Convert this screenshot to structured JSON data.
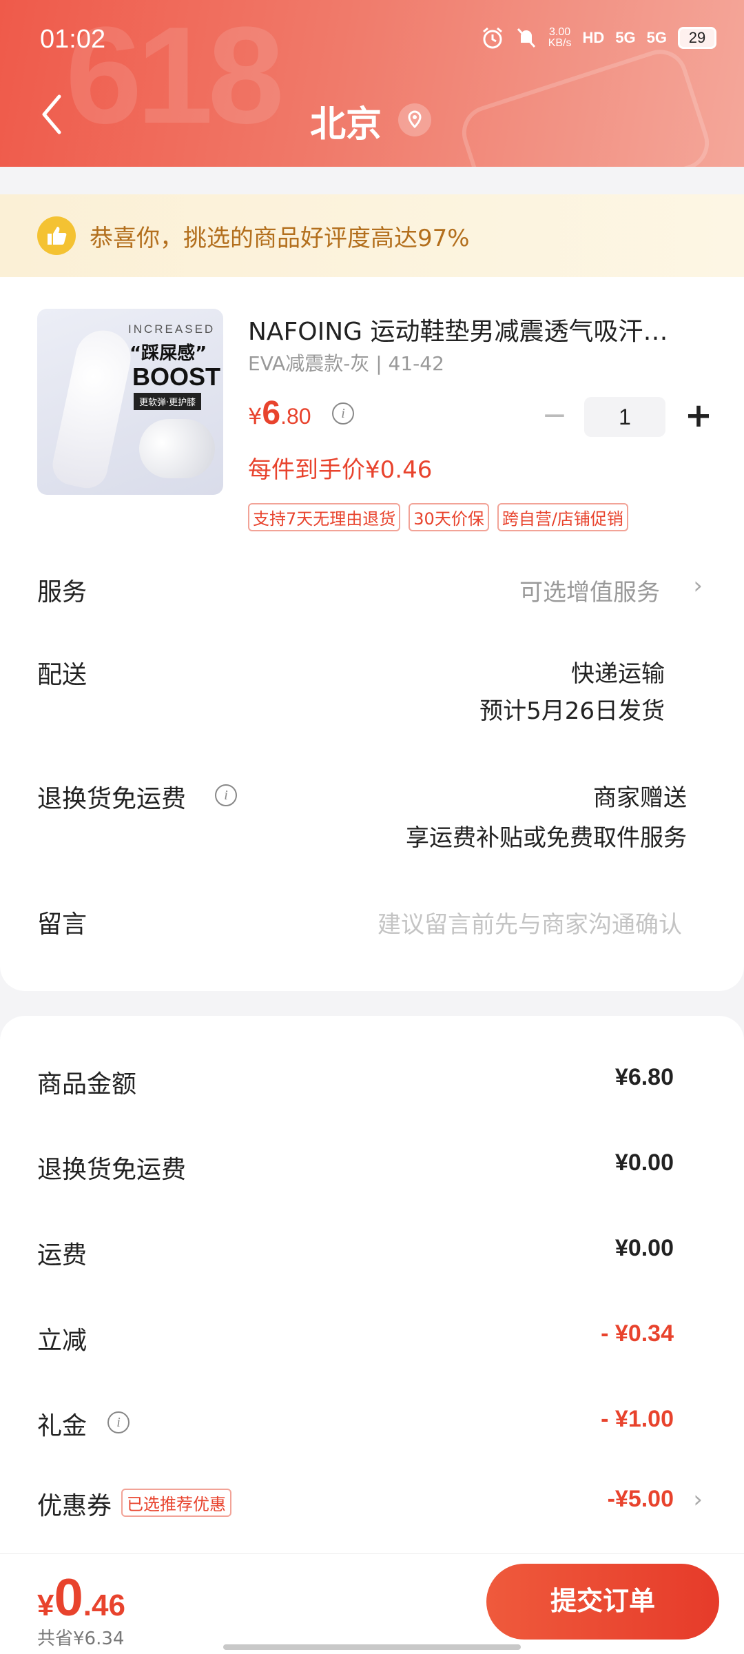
{
  "status_bar": {
    "time": "01:02",
    "speed": "3.00",
    "speed_unit": "KB/s",
    "hd": "HD",
    "net1": "5G",
    "net2": "5G",
    "battery": "29"
  },
  "nav": {
    "title": "北京"
  },
  "praise": {
    "text": "恭喜你，挑选的商品好评度高达97%"
  },
  "product": {
    "image_text": {
      "line1": "INCREASED",
      "line2": "“踩屎感”",
      "line3": "BOOST",
      "line4": "更软弹·更护膝"
    },
    "title": "NAFOING 运动鞋垫男减震透气吸汗…",
    "spec": "EVA减震款-灰 | 41-42",
    "price_currency": "¥",
    "price_int": "6",
    "price_dec": ".80",
    "unit_price": "每件到手价¥0.46",
    "quantity": "1",
    "minus": "−",
    "plus": "+",
    "tags": [
      "支持7天无理由退货",
      "30天价保",
      "跨自营/店铺促销"
    ]
  },
  "rows": {
    "service": {
      "label": "服务",
      "value": "可选增值服务"
    },
    "delivery": {
      "label": "配送",
      "value": "快递运输",
      "sub": "预计5月26日发货"
    },
    "return": {
      "label": "退换货免运费",
      "value": "商家赠送",
      "sub": "享运费补贴或免费取件服务"
    },
    "message": {
      "label": "留言",
      "placeholder": "建议留言前先与商家沟通确认"
    }
  },
  "summary": {
    "goods": {
      "label": "商品金额",
      "value": "¥6.80"
    },
    "return_fee": {
      "label": "退换货免运费",
      "value": "¥0.00"
    },
    "shipping": {
      "label": "运费",
      "value": "¥0.00"
    },
    "discount": {
      "label": "立减",
      "value": "- ¥0.34"
    },
    "gift": {
      "label": "礼金",
      "value": "- ¥1.00"
    },
    "coupon": {
      "label": "优惠券",
      "badge": "已选推荐优惠",
      "value": "-¥5.00"
    }
  },
  "bottom": {
    "currency": "¥",
    "total_int": "0",
    "total_dec": ".46",
    "saved": "共省¥6.34",
    "submit": "提交订单"
  },
  "colors": {
    "accent": "#e8432d",
    "header": "#ef5a4a",
    "praise_text": "#b36f1d"
  }
}
